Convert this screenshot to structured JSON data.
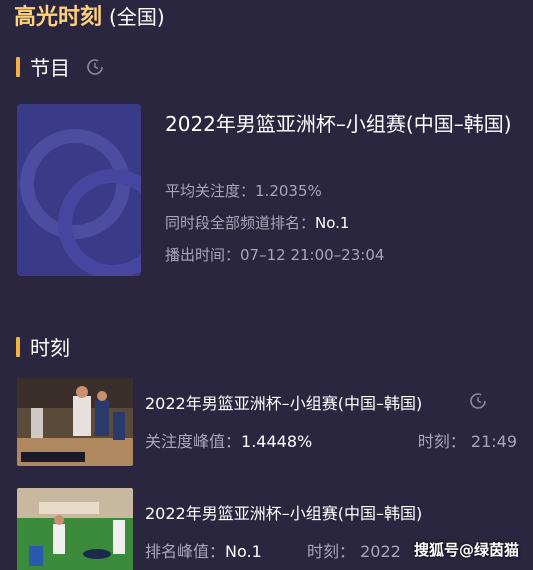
{
  "header": {
    "title": "高光时刻",
    "scope": "(全国)"
  },
  "program_section": {
    "label": "节目",
    "refresh_icon": "refresh-icon"
  },
  "program": {
    "title": "2022年男篮亚洲杯–小组赛(中国–韩国)",
    "avg_attention_label": "平均关注度：",
    "avg_attention_value": "1.2035%",
    "rank_label": "同时段全部频道排名：",
    "rank_value": "No.1",
    "airtime_label": "播出时间：",
    "airtime_value": "07–12 21:00–23:04"
  },
  "moments_section": {
    "label": "时刻"
  },
  "moments": [
    {
      "title": "2022年男篮亚洲杯–小组赛(中国–韩国)",
      "metric_label": "关注度峰值：",
      "metric_value": "1.4448%",
      "time_label": "时刻：",
      "time_value": "21:49"
    },
    {
      "title": "2022年男篮亚洲杯–小组赛(中国–韩国)",
      "metric_label": "排名峰值：",
      "metric_value": "No.1",
      "time_label": "时刻：",
      "time_value": "2022"
    }
  ],
  "watermark": "搜狐号@绿茵猫",
  "colors": {
    "background": "#2a2640",
    "accent": "#f3b242",
    "title": "#ffd27a",
    "muted": "#a8a6b9"
  }
}
